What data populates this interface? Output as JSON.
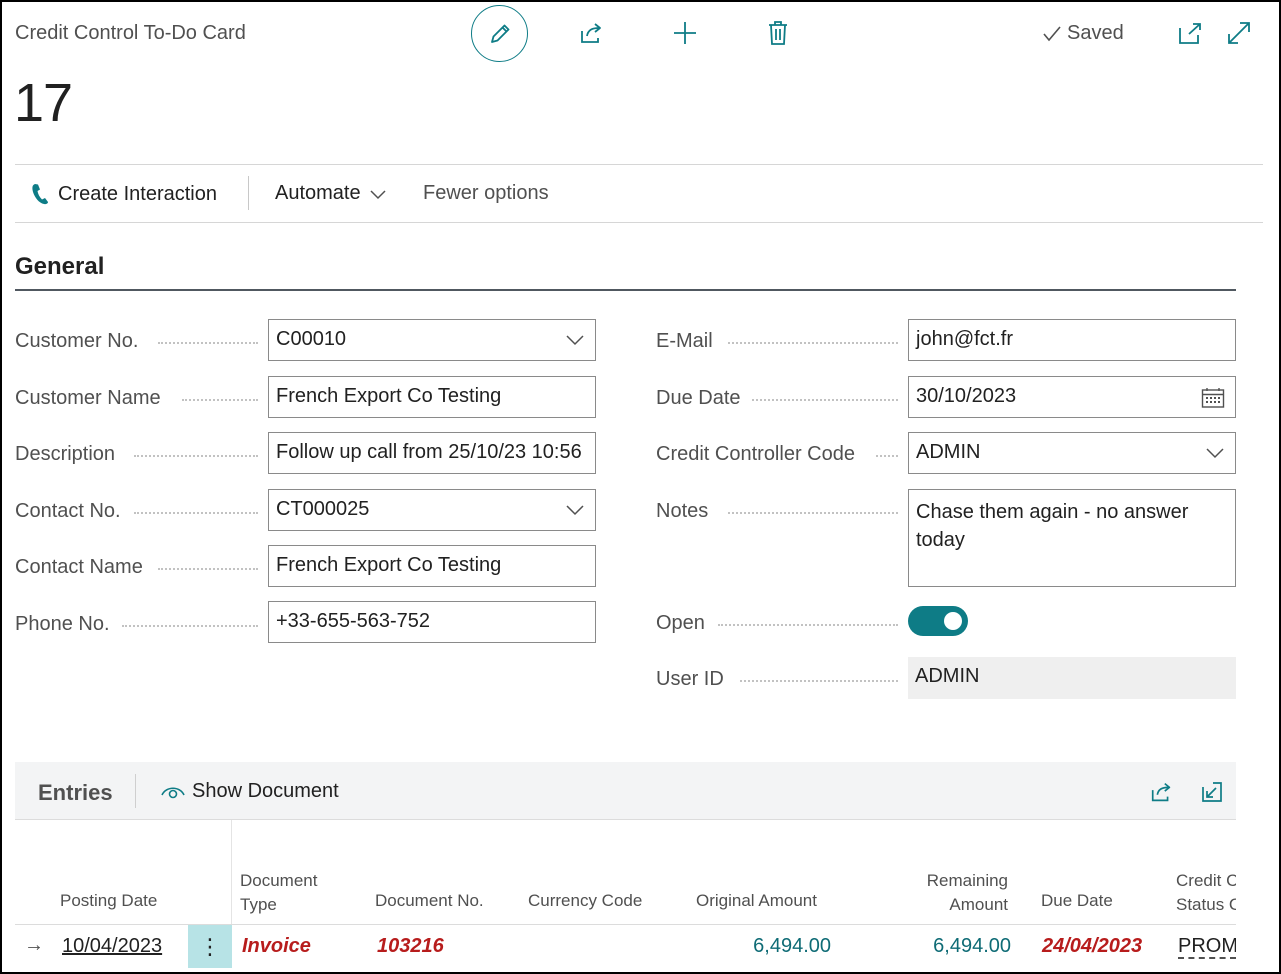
{
  "header": {
    "caption": "Credit Control To-Do Card",
    "record_no": "17",
    "saved_label": "Saved"
  },
  "actions": {
    "create_interaction": "Create Interaction",
    "automate": "Automate",
    "fewer_options": "Fewer options"
  },
  "general": {
    "title": "General",
    "left": [
      {
        "label": "Customer No.",
        "value": "C00010"
      },
      {
        "label": "Customer Name",
        "value": "French Export Co Testing"
      },
      {
        "label": "Description",
        "value": "Follow up call from 25/10/23 10:56"
      },
      {
        "label": "Contact No.",
        "value": "CT000025"
      },
      {
        "label": "Contact Name",
        "value": "French Export Co Testing"
      },
      {
        "label": "Phone No.",
        "value": "+33-655-563-752"
      }
    ],
    "right": [
      {
        "label": "E-Mail",
        "value": "john@fct.fr"
      },
      {
        "label": "Due Date",
        "value": "30/10/2023"
      },
      {
        "label": "Credit Controller Code",
        "value": "ADMIN"
      },
      {
        "label": "Notes",
        "value": "Chase them again - no answer today"
      },
      {
        "label": "Open",
        "value": true
      },
      {
        "label": "User ID",
        "value": "ADMIN"
      }
    ]
  },
  "entries": {
    "title": "Entries",
    "show_document": "Show Document",
    "columns": {
      "posting_date": "Posting Date",
      "document_type_1": "Document",
      "document_type_2": "Type",
      "document_no": "Document No.",
      "currency_code": "Currency Code",
      "original_amount": "Original Amount",
      "remaining_1": "Remaining",
      "remaining_2": "Amount",
      "due_date": "Due Date",
      "credit_status_1": "Credit C",
      "credit_status_2": "Status C"
    },
    "rows": [
      {
        "posting_date": "10/04/2023",
        "document_type": "Invoice",
        "document_no": "103216",
        "currency_code": "",
        "original_amount": "6,494.00",
        "remaining_amount": "6,494.00",
        "due_date": "24/04/2023",
        "credit_status": "PROM"
      }
    ]
  },
  "colors": {
    "accent": "#0e7c86",
    "overdue": "#b71c1c",
    "amount": "#0e6b75"
  }
}
